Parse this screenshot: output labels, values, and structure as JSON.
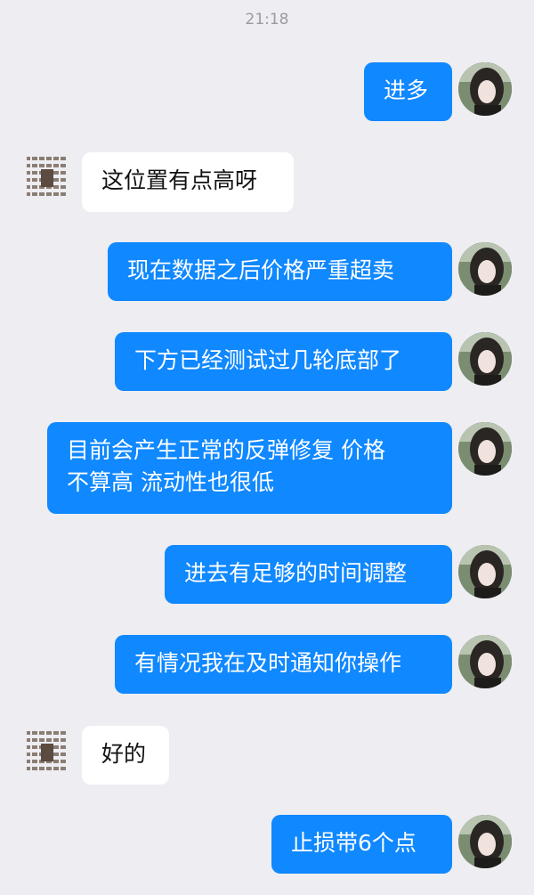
{
  "chat": {
    "timestamp": "21:18",
    "messages": [
      {
        "side": "out",
        "text": "进多"
      },
      {
        "side": "in",
        "text": "这位置有点高呀"
      },
      {
        "side": "out",
        "text": "现在数据之后价格严重超卖"
      },
      {
        "side": "out",
        "text": "下方已经测试过几轮底部了"
      },
      {
        "side": "out",
        "text": "目前会产生正常的反弹修复 价格\n不算高 流动性也很低"
      },
      {
        "side": "out",
        "text": "进去有足够的时间调整"
      },
      {
        "side": "out",
        "text": "有情况我在及时通知你操作"
      },
      {
        "side": "in",
        "text": "好的"
      },
      {
        "side": "out",
        "text": "止损带6个点"
      }
    ]
  }
}
